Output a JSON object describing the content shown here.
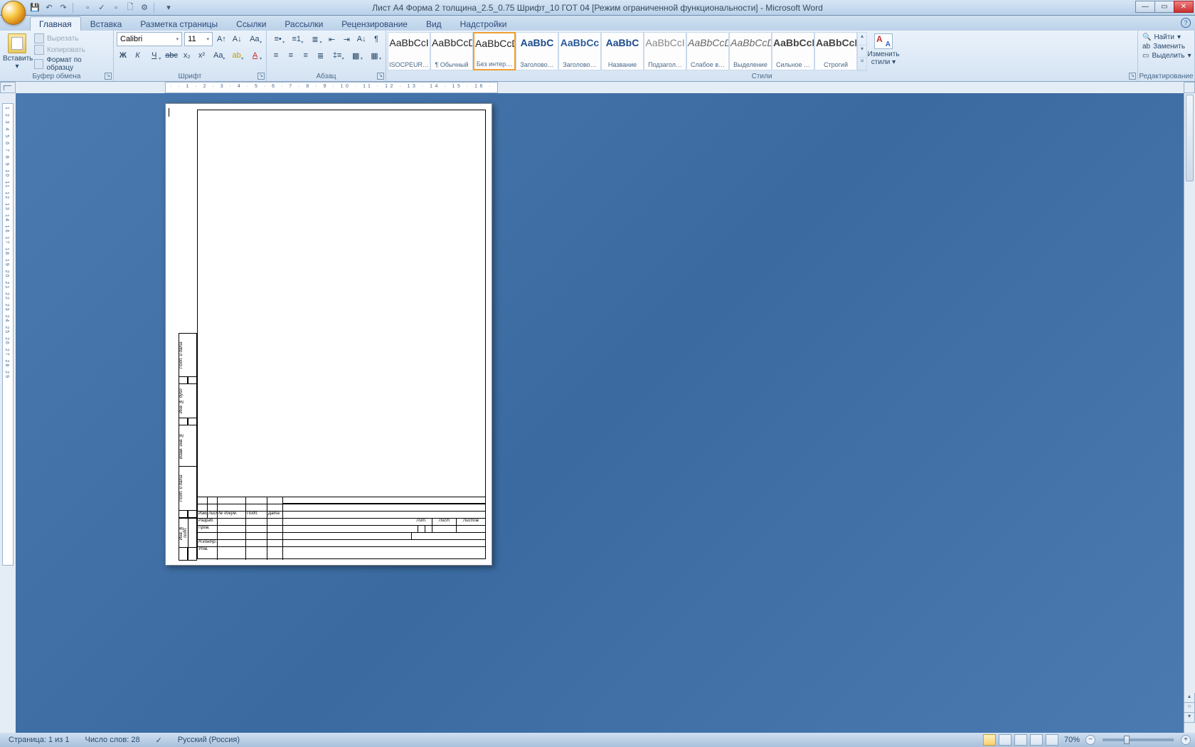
{
  "title": "Лист А4 Форма 2 толщина_2.5_0.75 Шрифт_10 ГОТ 04 [Режим ограниченной функциональности] - Microsoft Word",
  "tabs": {
    "home": "Главная",
    "insert": "Вставка",
    "layout": "Разметка страницы",
    "refs": "Ссылки",
    "mail": "Рассылки",
    "review": "Рецензирование",
    "view": "Вид",
    "addins": "Надстройки"
  },
  "clipboard": {
    "paste": "Вставить",
    "cut": "Вырезать",
    "copy": "Копировать",
    "format_painter": "Формат по образцу",
    "group": "Буфер обмена"
  },
  "font": {
    "name": "Calibri",
    "size": "11",
    "group": "Шрифт"
  },
  "paragraph": {
    "group": "Абзац"
  },
  "styles": {
    "group": "Стили",
    "items": [
      {
        "name": "ISOCPEUR…",
        "preview": "AaBbCcI",
        "cls": ""
      },
      {
        "name": "¶ Обычный",
        "preview": "AaBbCcDc",
        "cls": ""
      },
      {
        "name": "Без интер…",
        "preview": "AaBbCcDc",
        "cls": ""
      },
      {
        "name": "Заголово…",
        "preview": "AaBbC",
        "cls": "h1"
      },
      {
        "name": "Заголово…",
        "preview": "AaBbCc",
        "cls": "h2"
      },
      {
        "name": "Название",
        "preview": "AaBbC",
        "cls": "h1"
      },
      {
        "name": "Подзагол…",
        "preview": "AaBbCcI",
        "cls": "sub"
      },
      {
        "name": "Слабое в…",
        "preview": "AaBbCcDc",
        "cls": "em"
      },
      {
        "name": "Выделение",
        "preview": "AaBbCcDc",
        "cls": "em"
      },
      {
        "name": "Сильное …",
        "preview": "AaBbCcDc",
        "cls": "se"
      },
      {
        "name": "Строгий",
        "preview": "AaBbCcDc",
        "cls": "se"
      }
    ],
    "change": "Изменить стили"
  },
  "editing": {
    "find": "Найти",
    "replace": "Заменить",
    "select": "Выделить",
    "group": "Редактирование"
  },
  "doc": {
    "side": {
      "s1": "Подп. и дата",
      "s2": "Инв. № дубл",
      "s3": "Взам. инв. №",
      "s4": "Подп. и дата",
      "s5": "Инв. № подп."
    },
    "tb": {
      "izm": "Изм.",
      "list": "Лист",
      "ndoc": "№ докум.",
      "podp": "Подп.",
      "data": "Дата",
      "razrab": "Разраб.",
      "prov": "Пров.",
      "nkontr": "Н.контр.",
      "utv": "Утв.",
      "lit": "Лит.",
      "list2": "Лист",
      "listov": "Листов"
    }
  },
  "status": {
    "page": "Страница: 1 из 1",
    "words": "Число слов: 28",
    "lang": "Русский (Россия)",
    "zoom": "70%"
  }
}
